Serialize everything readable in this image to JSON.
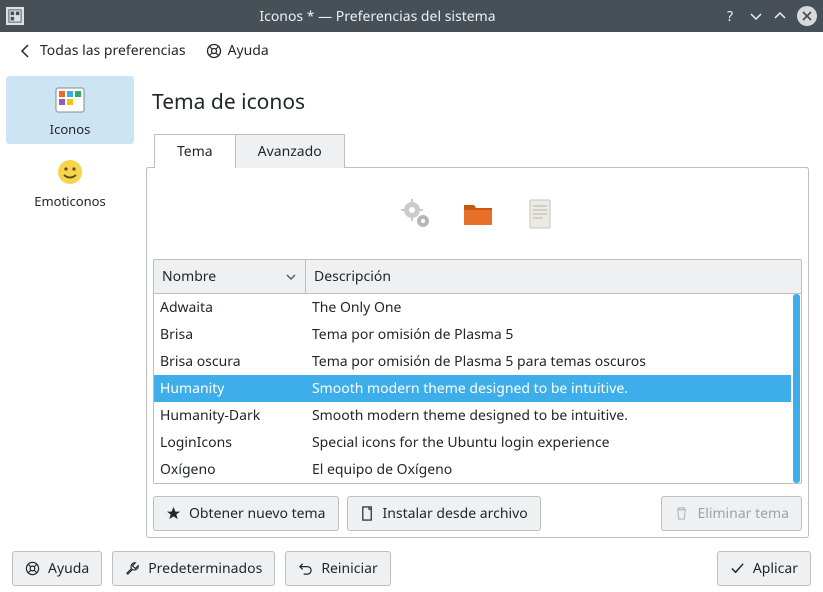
{
  "window": {
    "title": "Iconos * — Preferencias del sistema"
  },
  "breadcrumb": {
    "back_label": "Todas las preferencias",
    "help_label": "Ayuda"
  },
  "sidebar": {
    "items": [
      {
        "label": "Iconos",
        "selected": true
      },
      {
        "label": "Emoticonos",
        "selected": false
      }
    ]
  },
  "page": {
    "title": "Tema de iconos"
  },
  "tabs": {
    "items": [
      {
        "label": "Tema",
        "active": true
      },
      {
        "label": "Avanzado",
        "active": false
      }
    ]
  },
  "table": {
    "columns": {
      "name": "Nombre",
      "desc": "Descripción"
    },
    "rows": [
      {
        "name": "Adwaita",
        "desc": "The Only One",
        "selected": false
      },
      {
        "name": "Brisa",
        "desc": "Tema por omisión de Plasma 5",
        "selected": false
      },
      {
        "name": "Brisa oscura",
        "desc": "Tema por omisión de Plasma 5 para temas oscuros",
        "selected": false
      },
      {
        "name": "Humanity",
        "desc": "Smooth modern theme designed to be intuitive.",
        "selected": true
      },
      {
        "name": "Humanity-Dark",
        "desc": "Smooth modern theme designed to be intuitive.",
        "selected": false
      },
      {
        "name": "LoginIcons",
        "desc": "Special icons for the Ubuntu login experience",
        "selected": false
      },
      {
        "name": "Oxígeno",
        "desc": "El equipo de Oxígeno",
        "selected": false
      }
    ]
  },
  "actions": {
    "get_new": "Obtener nuevo tema",
    "install_file": "Instalar desde archivo",
    "remove": "Eliminar tema"
  },
  "footer": {
    "help": "Ayuda",
    "defaults": "Predeterminados",
    "reset": "Reiniciar",
    "apply": "Aplicar"
  },
  "colors": {
    "accent": "#3daee9",
    "titlebar": "#475057"
  }
}
